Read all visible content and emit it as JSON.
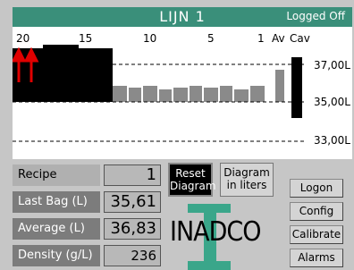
{
  "header": {
    "title": "LIJN 1",
    "status": "Logged Off"
  },
  "chart": {
    "scale_labels": [
      "20",
      "15",
      "10",
      "5",
      "1",
      "Av",
      "Cav"
    ],
    "levels": [
      "37,00L",
      "35,00L",
      "33,00L"
    ]
  },
  "panel": {
    "recipe": {
      "label": "Recipe",
      "value": "1"
    },
    "last_bag": {
      "label": "Last Bag (L)",
      "value": "35,61"
    },
    "average": {
      "label": "Average (L)",
      "value": "36,83"
    },
    "density": {
      "label": "Density (g/L)",
      "value": "236"
    }
  },
  "buttons": {
    "reset": "Reset Diagram",
    "diagram_liters": "Diagram in liters",
    "logon": "Logon",
    "config": "Config",
    "calibrate": "Calibrate",
    "alarms": "Alarms"
  },
  "logo": {
    "text": "INADCO"
  },
  "colors": {
    "header": "#3a8f7a",
    "logo_accent": "#3aa68a",
    "arrow": "#e00000"
  }
}
